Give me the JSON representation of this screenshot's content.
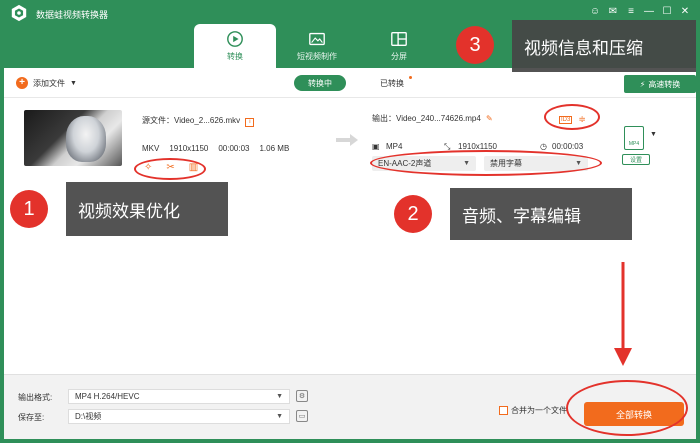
{
  "app": {
    "title": "数据蛙视频转换器"
  },
  "tabs": [
    {
      "label": "转换",
      "icon": "convert-icon"
    },
    {
      "label": "短视频制作",
      "icon": "video-make-icon"
    },
    {
      "label": "分屏",
      "icon": "split-screen-icon"
    }
  ],
  "toolbar": {
    "add_file": "添加文件",
    "converting": "转换中",
    "converted": "已转换",
    "high_speed": "高速转换"
  },
  "file": {
    "source_name": "源文件：Video_2...626.mkv",
    "src_format": "MKV",
    "src_resolution": "1910x1150",
    "src_duration": "00:00:03",
    "src_size": "1.06 MB",
    "output_name": "输出：Video_240...74626.mp4",
    "out_format": "MP4",
    "out_resolution": "1910x1150",
    "out_duration": "00:00:03",
    "audio_track": "EN-AAC-2声道",
    "subtitle": "禁用字幕",
    "format_badge": "MP4",
    "settings": "设置"
  },
  "bottom": {
    "output_format_label": "输出格式:",
    "output_format": "MP4 H.264/HEVC",
    "save_to_label": "保存至:",
    "save_path": "D:\\视频",
    "merge_label": "合并为一个文件",
    "convert_all": "全部转换"
  },
  "callouts": [
    {
      "number": "1",
      "text": "视频效果优化"
    },
    {
      "number": "2",
      "text": "音频、字幕编辑"
    },
    {
      "number": "3",
      "text": "视频信息和压缩"
    }
  ],
  "colors": {
    "brand_green": "#2f8f59",
    "accent_orange": "#f26b1d",
    "annotation_red": "#e3322b"
  }
}
